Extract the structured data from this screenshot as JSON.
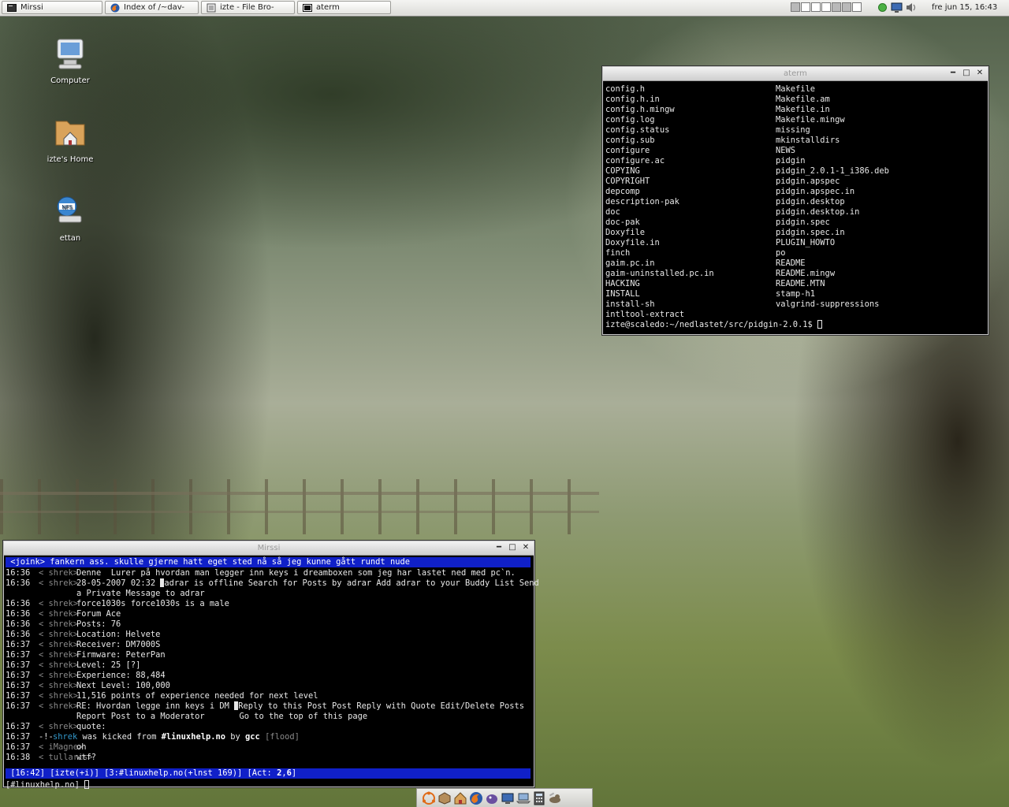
{
  "taskbar": {
    "tasks": [
      {
        "label": "Mirssi",
        "icon": "terminal-icon"
      },
      {
        "label": "Index of /~dav-",
        "icon": "firefox-icon"
      },
      {
        "label": "izte - File Bro-",
        "icon": "file-browser-icon"
      },
      {
        "label": "aterm",
        "icon": "terminal-icon"
      }
    ],
    "clock": "fre jun 15, 16:43"
  },
  "desktop_icons": [
    {
      "label": "Computer",
      "icon": "computer-icon"
    },
    {
      "label": "izte's Home",
      "icon": "home-folder-icon"
    },
    {
      "label": "ettan",
      "icon": "nfs-share-icon"
    }
  ],
  "aterm": {
    "title": "aterm",
    "left_column": [
      "config.h",
      "config.h.in",
      "config.h.mingw",
      "config.log",
      "config.status",
      "config.sub",
      "configure",
      "configure.ac",
      "COPYING",
      "COPYRIGHT",
      "depcomp",
      "description-pak",
      "doc",
      "doc-pak",
      "Doxyfile",
      "Doxyfile.in",
      "finch",
      "gaim.pc.in",
      "gaim-uninstalled.pc.in",
      "HACKING",
      "INSTALL",
      "install-sh",
      "intltool-extract"
    ],
    "right_column": [
      "Makefile",
      "Makefile.am",
      "Makefile.in",
      "Makefile.mingw",
      "missing",
      "mkinstalldirs",
      "NEWS",
      "pidgin",
      "pidgin_2.0.1-1_i386.deb",
      "pidgin.apspec",
      "pidgin.apspec.in",
      "pidgin.desktop",
      "pidgin.desktop.in",
      "pidgin.spec",
      "pidgin.spec.in",
      "PLUGIN_HOWTO",
      "po",
      "README",
      "README.mingw",
      "README.MTN",
      "stamp-h1",
      "valgrind-suppressions"
    ],
    "prompt": "izte@scaledo:~/nedlastet/src/pidgin-2.0.1$ "
  },
  "irssi": {
    "title": "Mirssi",
    "topic": " <joink> fankern ass. skulle gjerne hatt eget sted nå så jeg kunne gått rundt nude",
    "lines": [
      {
        "time": "16:36",
        "nick": "< shrek>",
        "msg": "Denne  Lurer på hvordan man legger inn keys i dreamboxen som jeg har lastet ned med pc`n."
      },
      {
        "time": "16:36",
        "nick": "< shrek>",
        "msg_pre": "28-05-2007 02:32 ",
        "msg": "adrar is offline Search for Posts by adrar Add adrar to your Buddy List Send"
      },
      {
        "time": "",
        "nick": "",
        "msg": "a Private Message to adrar"
      },
      {
        "time": "16:36",
        "nick": "< shrek>",
        "msg": "force1030s force1030s is a male"
      },
      {
        "time": "16:36",
        "nick": "< shrek>",
        "msg": "Forum Ace"
      },
      {
        "time": "16:36",
        "nick": "< shrek>",
        "msg": "Posts: 76"
      },
      {
        "time": "16:36",
        "nick": "< shrek>",
        "msg": "Location: Helvete"
      },
      {
        "time": "16:37",
        "nick": "< shrek>",
        "msg": "Receiver: DM7000S"
      },
      {
        "time": "16:37",
        "nick": "< shrek>",
        "msg": "Firmware: PeterPan"
      },
      {
        "time": "16:37",
        "nick": "< shrek>",
        "msg": "Level: 25 [?]"
      },
      {
        "time": "16:37",
        "nick": "< shrek>",
        "msg": "Experience: 88,484"
      },
      {
        "time": "16:37",
        "nick": "< shrek>",
        "msg": "Next Level: 100,000"
      },
      {
        "time": "16:37",
        "nick": "< shrek>",
        "msg": "11,516 points of experience needed for next level"
      },
      {
        "time": "16:37",
        "nick": "< shrek>",
        "msg_pre": "RE: Hvordan legge inn keys i DM ",
        "msg": "Reply to this Post Post Reply with Quote Edit/Delete Posts"
      },
      {
        "time": "",
        "nick": "",
        "msg": "Report Post to a Moderator       Go to the top of this page"
      },
      {
        "time": "16:37",
        "nick": "< shrek>",
        "msg": "quote:"
      }
    ],
    "kick": {
      "time": "16:37",
      "marker": "-!-",
      "nick": "shrek",
      "text1": "was kicked from",
      "channel": "#linuxhelp.no",
      "text2": "by",
      "by": "gcc",
      "reason": "[flood]"
    },
    "tail_lines": [
      {
        "time": "16:37",
        "nick": "< iMagne>",
        "msg": "oh"
      },
      {
        "time": "16:38",
        "nick": "< tullaris>",
        "msg": "wtf?"
      }
    ],
    "status": {
      "pre": " [16:42] [izte(+i)] [3:#linuxhelp.no(+lnst 169)] [Act: ",
      "act1": "2",
      "sep": ",",
      "act2": "6",
      "post": "]"
    },
    "input_prompt": "[#linuxhelp.no] "
  },
  "dock_icons": [
    "ubuntu-menu-icon",
    "package-icon",
    "home-icon",
    "firefox-icon",
    "pidgin-icon",
    "display-icon",
    "laptop-icon",
    "calculator-icon",
    "gimp-icon"
  ]
}
